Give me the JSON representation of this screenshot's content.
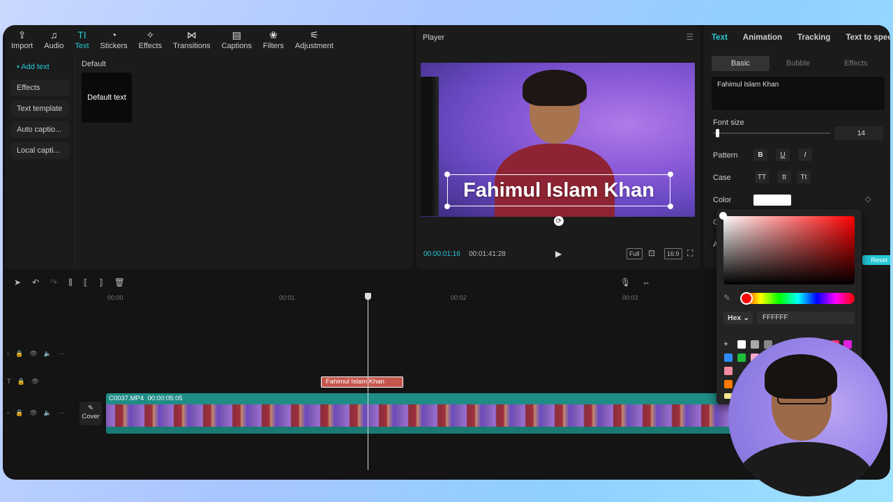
{
  "toolbar": {
    "items": [
      {
        "label": "Import",
        "icon": "import-icon"
      },
      {
        "label": "Audio",
        "icon": "audio-icon"
      },
      {
        "label": "Text",
        "icon": "text-icon",
        "active": true
      },
      {
        "label": "Stickers",
        "icon": "stickers-icon"
      },
      {
        "label": "Effects",
        "icon": "effects-icon"
      },
      {
        "label": "Transitions",
        "icon": "transitions-icon"
      },
      {
        "label": "Captions",
        "icon": "captions-icon"
      },
      {
        "label": "Filters",
        "icon": "filters-icon"
      },
      {
        "label": "Adjustment",
        "icon": "adjustment-icon"
      }
    ]
  },
  "library": {
    "sidebar": [
      "• Add text",
      "Effects",
      "Text template",
      "Auto captio...",
      "Local capti..."
    ],
    "section_title": "Default",
    "card_label": "Default text"
  },
  "player": {
    "title": "Player",
    "overlay_text": "Fahimul Islam Khan",
    "time_current": "00:00:01:16",
    "time_total": "00:01:41:28",
    "ctl_full": "Full",
    "ctl_ratio": "16:9"
  },
  "properties": {
    "tabs": [
      "Text",
      "Animation",
      "Tracking",
      "Text to speech"
    ],
    "subtabs": [
      "Basic",
      "Bubble",
      "Effects"
    ],
    "text_value": "Fahimul Islam Khan",
    "font_size_label": "Font size",
    "font_size_value": "14",
    "pattern_label": "Pattern",
    "pattern_buttons": [
      "B",
      "U",
      "I"
    ],
    "case_label": "Case",
    "case_buttons": [
      "TT",
      "tt",
      "Tt"
    ],
    "color_label": "Color",
    "row_cut_1": "Cl",
    "row_cut_2": "Al",
    "reset_label": "Reset"
  },
  "color_picker": {
    "format_label": "Hex",
    "hex_value": "FFFFFF",
    "current_color": "#FFFFFF",
    "swatch_colors": [
      "#FFFFFF",
      "#AAAAAA",
      "#888888",
      "#2E8BFF",
      "#1FBF3A",
      "#F7A6C8",
      "#F38BA0",
      "#FF7A00",
      "#F0E68C",
      "#FF2D6F",
      "#E020E0"
    ]
  },
  "timeline": {
    "ruler": [
      "00:00",
      "00:01",
      "00:02",
      "00:03"
    ],
    "text_clip_label": "Fahimul Islam Khan",
    "video_clip_name": "C0037.MP4",
    "video_clip_duration": "00:00:05:05",
    "cover_label": "Cover"
  },
  "colors": {
    "accent": "#26C9D6",
    "text_clip": "#C5564C",
    "video_clip": "#1F8C86"
  }
}
